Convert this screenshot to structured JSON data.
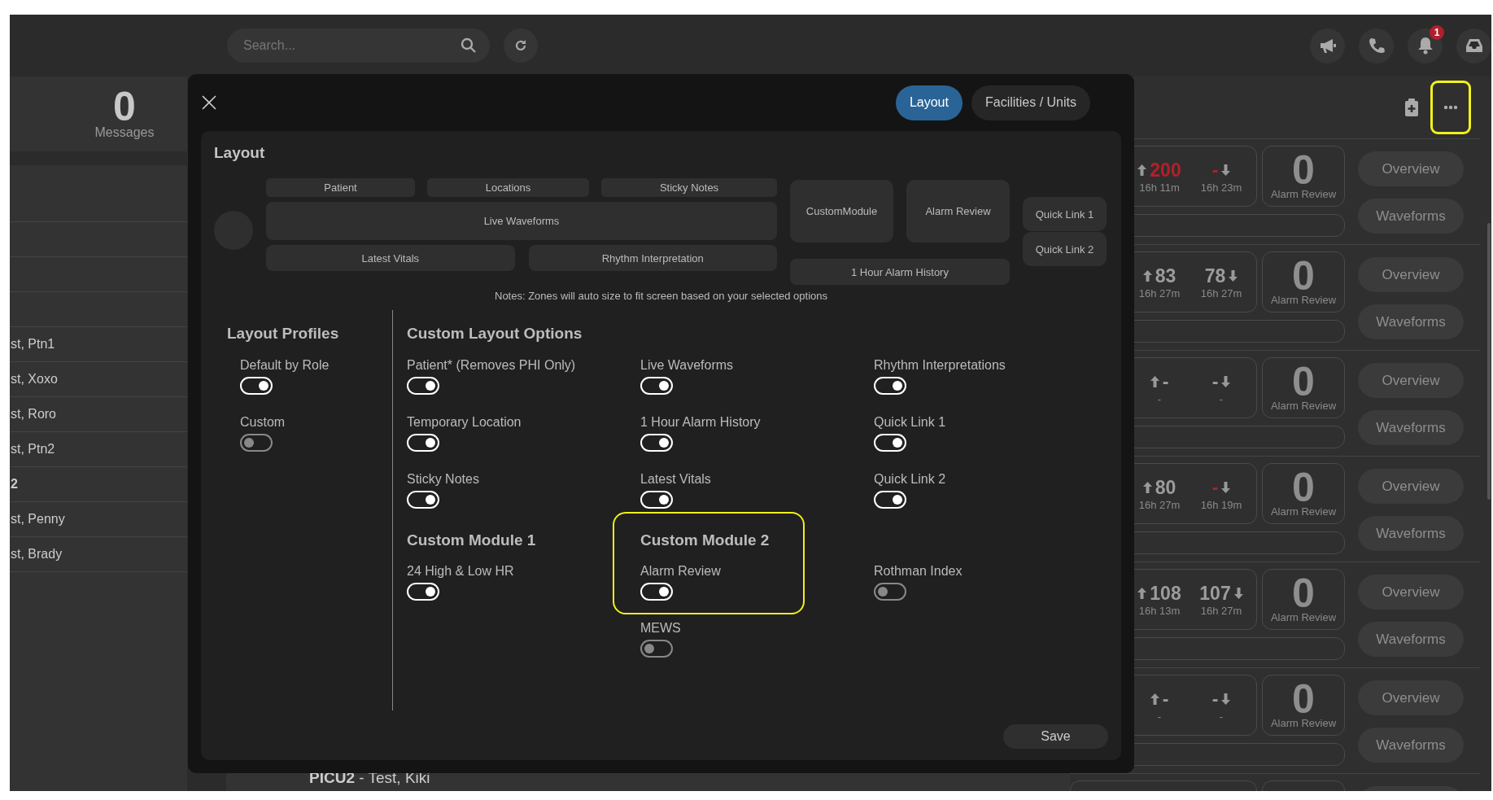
{
  "topbar": {
    "search": {
      "placeholder": "Search..."
    },
    "notification_count": "1"
  },
  "sidebar": {
    "messages": {
      "count": "0",
      "label": "Messages"
    },
    "rows": [
      {
        "text": "st, Ptn1",
        "bold": false
      },
      {
        "text": "st, Xoxo",
        "bold": false
      },
      {
        "text": "st, Roro",
        "bold": false
      },
      {
        "text": "st, Ptn2",
        "bold": false
      },
      {
        "text": "2",
        "bold": true
      },
      {
        "text": "st, Penny",
        "bold": false
      },
      {
        "text": "st, Brady",
        "bold": false
      }
    ]
  },
  "bottom_patient": "**PICU2** - Test, Kiki",
  "right_header": {
    "more_highlighted": true
  },
  "patient_rows": [
    {
      "up": {
        "value": "200",
        "time": "16h 11m",
        "alert": true
      },
      "down": {
        "value": "-",
        "time": "16h 23m",
        "alert": true
      },
      "alarm_count": "0",
      "alarm_label": "Alarm Review",
      "buttons": [
        "Overview",
        "Waveforms"
      ]
    },
    {
      "up": {
        "value": "83",
        "time": "16h 27m",
        "alert": false
      },
      "down": {
        "value": "78",
        "time": "16h 27m",
        "alert": false
      },
      "alarm_count": "0",
      "alarm_label": "Alarm Review",
      "buttons": [
        "Overview",
        "Waveforms"
      ]
    },
    {
      "up": {
        "value": "-",
        "time": "-",
        "alert": false
      },
      "down": {
        "value": "-",
        "time": "-",
        "alert": false
      },
      "alarm_count": "0",
      "alarm_label": "Alarm Review",
      "buttons": [
        "Overview",
        "Waveforms"
      ]
    },
    {
      "up": {
        "value": "80",
        "time": "16h 27m",
        "alert": false
      },
      "down": {
        "value": "-",
        "time": "16h 19m",
        "alert": true
      },
      "alarm_count": "0",
      "alarm_label": "Alarm Review",
      "buttons": [
        "Overview",
        "Waveforms"
      ]
    },
    {
      "up": {
        "value": "108",
        "time": "16h 13m",
        "alert": false
      },
      "down": {
        "value": "107",
        "time": "16h 27m",
        "alert": false
      },
      "alarm_count": "0",
      "alarm_label": "Alarm Review",
      "buttons": [
        "Overview",
        "Waveforms"
      ]
    },
    {
      "up": {
        "value": "-",
        "time": "-",
        "alert": false
      },
      "down": {
        "value": "-",
        "time": "-",
        "alert": false
      },
      "alarm_count": "0",
      "alarm_label": "Alarm Review",
      "buttons": [
        "Overview",
        "Waveforms"
      ]
    }
  ],
  "modal": {
    "tabs": [
      {
        "label": "Layout",
        "selected": true
      },
      {
        "label": "Facilities / Units",
        "selected": false
      }
    ],
    "layout": {
      "title": "Layout",
      "zones": [
        "Patient",
        "Locations",
        "Sticky Notes",
        "Live Waveforms",
        "Latest Vitals",
        "Rhythm Interpretation",
        "CustomModule",
        "Alarm Review",
        "1 Hour Alarm History",
        "Quick Link 1",
        "Quick Link 2"
      ],
      "notes": "Notes: Zones will auto size to fit screen based on your selected options"
    },
    "profiles": {
      "title": "Layout Profiles",
      "items": [
        {
          "label": "Default by Role",
          "on": true
        },
        {
          "label": "Custom",
          "on": false
        }
      ]
    },
    "options": {
      "title": "Custom Layout Options",
      "items": [
        {
          "label": "Patient* (Removes PHI Only)",
          "on": true
        },
        {
          "label": "Live Waveforms",
          "on": true
        },
        {
          "label": "Rhythm Interpretations",
          "on": true
        },
        {
          "label": "Temporary Location",
          "on": true
        },
        {
          "label": "1 Hour Alarm History",
          "on": true
        },
        {
          "label": "Quick Link 1",
          "on": true
        },
        {
          "label": "Sticky Notes",
          "on": true
        },
        {
          "label": "Latest Vitals",
          "on": true
        },
        {
          "label": "Quick Link 2",
          "on": true
        }
      ]
    },
    "modules": [
      {
        "title": "Custom Module 1",
        "highlighted": false,
        "items": [
          {
            "label": "24 High & Low HR",
            "on": true
          }
        ]
      },
      {
        "title": "Custom Module 2",
        "highlighted": true,
        "items": [
          {
            "label": "Alarm Review",
            "on": true
          }
        ],
        "more_items": [
          {
            "label": "MEWS",
            "on": false
          }
        ]
      },
      {
        "highlighted": false,
        "items": [
          {
            "label": "Rothman Index",
            "on": false
          }
        ]
      }
    ],
    "save": "Save"
  }
}
